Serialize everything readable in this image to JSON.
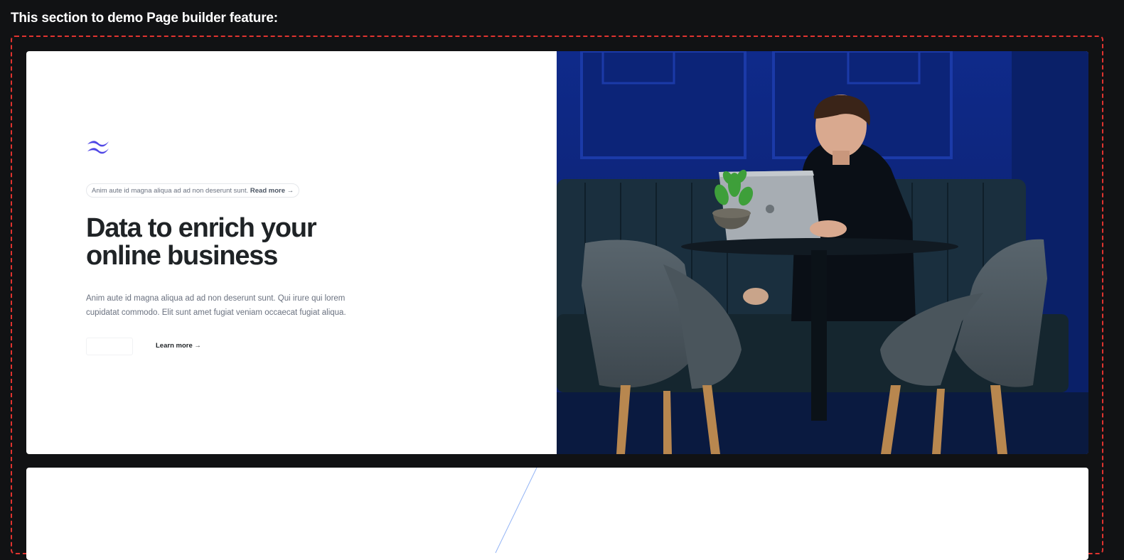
{
  "page": {
    "heading": "This section to demo Page builder feature:"
  },
  "hero": {
    "logo_icon": "tailwind-waves-logo",
    "announcement": {
      "text": "Anim aute id magna aliqua ad ad non deserunt sunt.",
      "link": "Read more →"
    },
    "title_line1": "Data to enrich your",
    "title_line2": "online business",
    "description": "Anim aute id magna aliqua ad ad non deserunt sunt. Qui irure qui lorem cupidatat commodo. Elit sunt amet fugiat veniam occaecat fugiat aliqua.",
    "primary_button_label": "",
    "secondary_link": "Learn more →",
    "image_subject": "person-with-laptop-cafe-photo"
  },
  "colors": {
    "accent": "#4f46e5",
    "frame_border": "#e0332f",
    "background": "#111214"
  }
}
